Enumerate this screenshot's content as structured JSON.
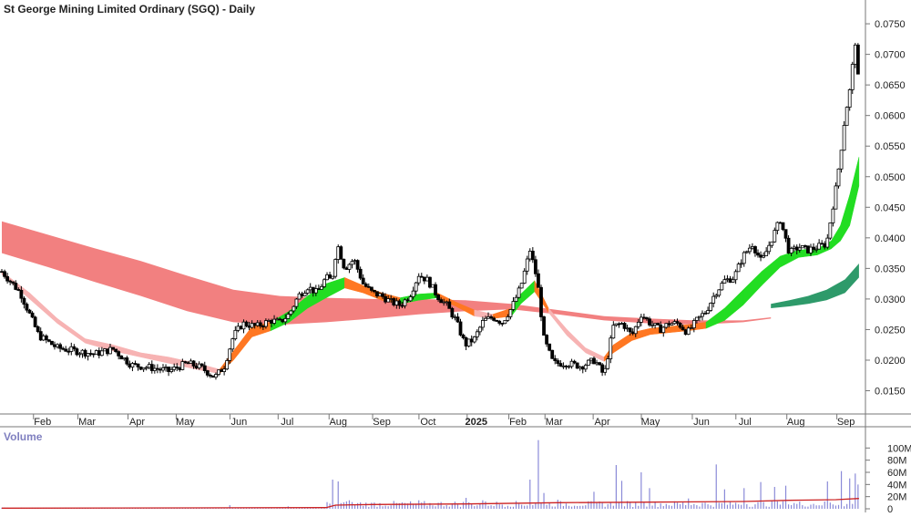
{
  "chart_data": {
    "type": "candlestick",
    "title": "St George Mining Limited Ordinary (SGQ) - Daily",
    "price_axis": {
      "ylim": [
        0.0115,
        0.0768
      ],
      "ticks": [
        "0.0750",
        "0.0700",
        "0.0650",
        "0.0600",
        "0.0550",
        "0.0500",
        "0.0450",
        "0.0400",
        "0.0350",
        "0.0300",
        "0.0250",
        "0.0200",
        "0.0150"
      ]
    },
    "x_axis": {
      "labels": [
        "Feb",
        "Mar",
        "Apr",
        "May",
        "Jun",
        "Jul",
        "Aug",
        "Sep",
        "Oct",
        "2025",
        "Feb",
        "Mar",
        "Apr",
        "May",
        "Jun",
        "Jul",
        "Aug",
        "Sep"
      ],
      "label_days": [
        44,
        92,
        146,
        198,
        256,
        308,
        363,
        410,
        460,
        512,
        557,
        596,
        648,
        700,
        755,
        802,
        857,
        911
      ]
    },
    "price_series": {
      "days": [
        0,
        20,
        40,
        60,
        80,
        100,
        120,
        140,
        160,
        180,
        200,
        215,
        230,
        240,
        250,
        260,
        275,
        290,
        300,
        310,
        320,
        330,
        340,
        350,
        356,
        362,
        370,
        380,
        390,
        400,
        410,
        420,
        430,
        440,
        450,
        460,
        470,
        480,
        490,
        500,
        510,
        520,
        530,
        540,
        550,
        560,
        570,
        578,
        585,
        595,
        610,
        625,
        640,
        650,
        660,
        670,
        680,
        690,
        700,
        710,
        720,
        730,
        740,
        750,
        760,
        770,
        780,
        790,
        800,
        810,
        820,
        830,
        840,
        850,
        860,
        870,
        880,
        890,
        900,
        905,
        910,
        915,
        918,
        920,
        922,
        924
      ],
      "close": [
        0.0345,
        0.031,
        0.024,
        0.022,
        0.0215,
        0.021,
        0.0218,
        0.0192,
        0.0188,
        0.0182,
        0.0195,
        0.0188,
        0.0172,
        0.019,
        0.024,
        0.026,
        0.0255,
        0.0265,
        0.0262,
        0.0275,
        0.0305,
        0.032,
        0.031,
        0.0335,
        0.033,
        0.039,
        0.035,
        0.0365,
        0.0325,
        0.031,
        0.0305,
        0.0295,
        0.029,
        0.0305,
        0.034,
        0.033,
        0.0305,
        0.029,
        0.0265,
        0.0225,
        0.0235,
        0.0265,
        0.027,
        0.0262,
        0.0285,
        0.032,
        0.038,
        0.033,
        0.0235,
        0.0195,
        0.0195,
        0.019,
        0.02,
        0.0175,
        0.0255,
        0.026,
        0.024,
        0.0275,
        0.026,
        0.025,
        0.026,
        0.026,
        0.0245,
        0.0265,
        0.028,
        0.031,
        0.033,
        0.0335,
        0.037,
        0.039,
        0.036,
        0.0395,
        0.043,
        0.0375,
        0.0385,
        0.038,
        0.0385,
        0.039,
        0.048,
        0.0535,
        0.06,
        0.064,
        0.068,
        0.071,
        0.073,
        0.0662
      ],
      "high_low_spread": 0.0012
    },
    "red_band": {
      "days": [
        0,
        50,
        100,
        150,
        200,
        250,
        300,
        350,
        400,
        450,
        500,
        550,
        600,
        650,
        700,
        750,
        800,
        830
      ],
      "upper": [
        0.0427,
        0.0405,
        0.0383,
        0.0362,
        0.0338,
        0.0315,
        0.0305,
        0.0302,
        0.03,
        0.03,
        0.0298,
        0.0292,
        0.0282,
        0.0272,
        0.0268,
        0.0265,
        0.0265,
        0.027
      ],
      "lower": [
        0.0375,
        0.0352,
        0.0328,
        0.0305,
        0.028,
        0.0262,
        0.0258,
        0.0262,
        0.0268,
        0.0275,
        0.028,
        0.0283,
        0.0275,
        0.0265,
        0.026,
        0.0258,
        0.0262,
        0.0268
      ]
    },
    "green_band_long": {
      "days": [
        830,
        850,
        870,
        890,
        910,
        925
      ],
      "upper": [
        0.0292,
        0.0298,
        0.0305,
        0.0315,
        0.0332,
        0.0358
      ],
      "lower": [
        0.0285,
        0.0288,
        0.0292,
        0.0298,
        0.031,
        0.0335
      ]
    },
    "short_band": {
      "days": [
        0,
        30,
        60,
        90,
        120,
        150,
        180,
        210,
        235,
        250,
        270,
        290,
        310,
        330,
        350,
        370,
        390,
        410,
        430,
        450,
        470,
        490,
        510,
        530,
        550,
        560,
        575,
        590,
        610,
        630,
        650,
        660,
        680,
        700,
        720,
        740,
        760,
        780,
        800,
        820,
        840,
        860,
        880,
        895,
        905,
        915,
        925
      ],
      "upper": [
        0.0345,
        0.031,
        0.0268,
        0.0235,
        0.0225,
        0.0212,
        0.0205,
        0.0195,
        0.0185,
        0.0215,
        0.0255,
        0.0262,
        0.028,
        0.0305,
        0.0325,
        0.0335,
        0.0322,
        0.031,
        0.0302,
        0.0308,
        0.031,
        0.0295,
        0.0282,
        0.0275,
        0.0285,
        0.0308,
        0.033,
        0.0285,
        0.025,
        0.022,
        0.0205,
        0.0225,
        0.0245,
        0.0252,
        0.0255,
        0.0258,
        0.0262,
        0.0285,
        0.0315,
        0.0345,
        0.037,
        0.038,
        0.0382,
        0.0395,
        0.042,
        0.047,
        0.0532
      ],
      "lower": [
        0.034,
        0.03,
        0.026,
        0.0228,
        0.0215,
        0.0205,
        0.0195,
        0.0185,
        0.0178,
        0.02,
        0.0238,
        0.0248,
        0.0262,
        0.0285,
        0.0302,
        0.0318,
        0.031,
        0.0298,
        0.0292,
        0.0298,
        0.0302,
        0.0288,
        0.0272,
        0.0268,
        0.0272,
        0.0292,
        0.0312,
        0.0278,
        0.024,
        0.0212,
        0.0198,
        0.0212,
        0.0232,
        0.0242,
        0.0245,
        0.0248,
        0.0252,
        0.0265,
        0.029,
        0.0322,
        0.0352,
        0.0368,
        0.0372,
        0.0382,
        0.0395,
        0.042,
        0.0485
      ]
    },
    "volume_panel": {
      "label": "Volume",
      "ylim": [
        0,
        120
      ],
      "ticks": [
        "100M",
        "80M",
        "60M",
        "40M",
        "20M",
        "0"
      ],
      "spikes": [
        {
          "day": 245,
          "v": 6
        },
        {
          "day": 310,
          "v": 4
        },
        {
          "day": 356,
          "v": 48
        },
        {
          "day": 362,
          "v": 45
        },
        {
          "day": 375,
          "v": 14
        },
        {
          "day": 400,
          "v": 10
        },
        {
          "day": 450,
          "v": 14
        },
        {
          "day": 500,
          "v": 18
        },
        {
          "day": 520,
          "v": 14
        },
        {
          "day": 570,
          "v": 48
        },
        {
          "day": 578,
          "v": 113
        },
        {
          "day": 585,
          "v": 26
        },
        {
          "day": 600,
          "v": 15
        },
        {
          "day": 640,
          "v": 28
        },
        {
          "day": 662,
          "v": 72
        },
        {
          "day": 668,
          "v": 46
        },
        {
          "day": 690,
          "v": 60
        },
        {
          "day": 700,
          "v": 34
        },
        {
          "day": 742,
          "v": 17
        },
        {
          "day": 770,
          "v": 73
        },
        {
          "day": 780,
          "v": 32
        },
        {
          "day": 800,
          "v": 34
        },
        {
          "day": 820,
          "v": 44
        },
        {
          "day": 835,
          "v": 36
        },
        {
          "day": 845,
          "v": 38
        },
        {
          "day": 890,
          "v": 45
        },
        {
          "day": 905,
          "v": 62
        },
        {
          "day": 915,
          "v": 50
        },
        {
          "day": 920,
          "v": 58
        },
        {
          "day": 924,
          "v": 40
        }
      ],
      "ma_line": {
        "days": [
          0,
          200,
          350,
          360,
          400,
          500,
          600,
          700,
          800,
          850,
          900,
          925
        ],
        "values": [
          1,
          1.5,
          2,
          6,
          7,
          8,
          10,
          11,
          12,
          14,
          15,
          17
        ]
      }
    },
    "colors": {
      "red_band": "#f28080",
      "pink_band": "#f7b3b3",
      "orange_band": "#ff7722",
      "green_band": "#22dd22",
      "dark_green_band": "#2e9a6a",
      "volume_bar": "#8a8ad8",
      "volume_ma": "#cc2222",
      "candle": "#000000",
      "grid_axis": "#777777"
    },
    "grid": false,
    "legend": "none"
  }
}
